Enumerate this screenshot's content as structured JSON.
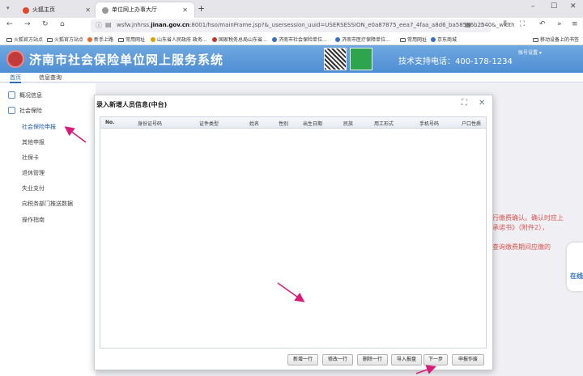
{
  "browser": {
    "tabs": [
      {
        "title": "火狐主页"
      },
      {
        "title": "单位网上办事大厅"
      }
    ],
    "url_prefix": "wsfw.jnhrss.",
    "url_domain": "jinan.gov.cn",
    "url_suffix": ":8001/hso/mainFrame.jsp?&_usersession_uuid=USERSESSION_e0a87875_eea7_4faa_a8d6_ba58586b2540&_width",
    "bookmarks": [
      "火狐官方站点",
      "火狐官方站点",
      "新手上路",
      "常用网址",
      "山东省人民政府 政务...",
      "国家税务总局山东省...",
      "济南市社会保险单位...",
      "济南市医疗保障单位...",
      "常用网址",
      "京东商城"
    ],
    "mobile_bookmarks": "移动设备上的书签"
  },
  "header": {
    "title": "济南市社会保险单位网上服务系统",
    "hotline": "技术支持电话：400-178-1234",
    "account": "账号设置 ▾"
  },
  "site_tabs": [
    "首页",
    "信息查询"
  ],
  "sidebar": {
    "groups": [
      {
        "label": "概况信息"
      },
      {
        "label": "社会保险"
      }
    ],
    "items": [
      "社会保险申报",
      "其他申报",
      "社保卡",
      "退休管理",
      "失业支付",
      "向税务部门推送数据",
      "操作指南"
    ]
  },
  "notice": {
    "line1": "进行缴费确认。确认时应上",
    "line2": "诺承诺书》（附件2），",
    "line3": "可查询缴费期间应缴的"
  },
  "float": {
    "label": "在线"
  },
  "modal": {
    "title": "录入新增人员信息(中台)",
    "columns": [
      "No.",
      "身份证号码",
      "证件类型",
      "姓名",
      "性别",
      "出生日期",
      "民族",
      "用工形式",
      "手机号码",
      "户口性质"
    ],
    "buttons": [
      "新增一行",
      "修改一行",
      "删除一行",
      "导入报盘",
      "下一步",
      "申报作废"
    ]
  },
  "colors": {
    "header_blue": "#4f8ed4",
    "accent_red": "#d9534f",
    "arrow_magenta": "#d81b78"
  }
}
